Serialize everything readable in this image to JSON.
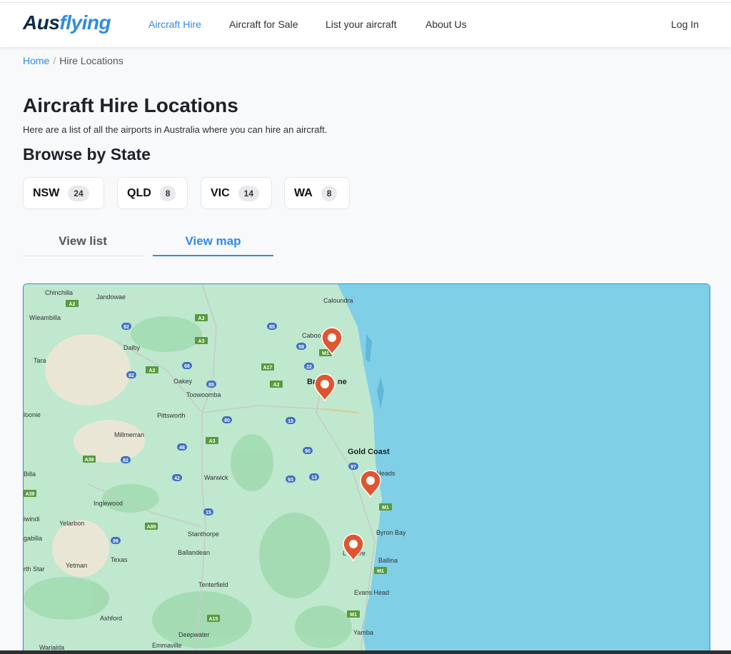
{
  "brand": {
    "logo_part1": "Aus",
    "logo_part2": "flying"
  },
  "nav": {
    "links": [
      "Aircraft Hire",
      "Aircraft for Sale",
      "List your aircraft",
      "About Us"
    ],
    "login": "Log In"
  },
  "breadcrumb": {
    "home": "Home",
    "sep": "/",
    "current": "Hire Locations"
  },
  "page": {
    "title": "Aircraft Hire Locations",
    "intro": "Here are a list of all the airports in Australia where you can hire an aircraft.",
    "browse_heading": "Browse by State"
  },
  "states": [
    {
      "name": "NSW",
      "count": "24"
    },
    {
      "name": "QLD",
      "count": "8"
    },
    {
      "name": "VIC",
      "count": "14"
    },
    {
      "name": "WA",
      "count": "8"
    }
  ],
  "tabs": {
    "list": "View list",
    "map": "View map",
    "active": "View map"
  },
  "map": {
    "place_names": [
      "Chinchilla",
      "Jandowae",
      "Caloundra",
      "Wieambilla",
      "Caboo",
      "Dalby",
      "Tara",
      "Oakey",
      "Bris",
      "ne",
      "Toowoomba",
      "loonie",
      "Pittsworth",
      "Millmerran",
      "Gold Coast",
      "Billa",
      "Warwick",
      "d Heads",
      "Inglewood",
      "iwindi",
      "Yelarbon",
      "gabilla",
      "Stanthorpe",
      "Byron Bay",
      "Ballandean",
      "Texas",
      "Yetman",
      "rth Star",
      "L",
      "ore",
      "Ballina",
      "Tenterfield",
      "Evans Head",
      "Ashford",
      "Deepwater",
      "Yamba",
      "Warialda",
      "Emmaville"
    ],
    "road_shields": [
      "A2",
      "A3",
      "82",
      "85",
      "A3",
      "68",
      "A2",
      "82",
      "85",
      "A2",
      "A17",
      "22",
      "58",
      "M1",
      "15",
      "80",
      "A3",
      "90",
      "97",
      "A39",
      "82",
      "42",
      "93",
      "13",
      "15",
      "A39",
      "A89",
      "89",
      "M1",
      "M1",
      "M1",
      "A15",
      "48"
    ],
    "markers": 4
  }
}
